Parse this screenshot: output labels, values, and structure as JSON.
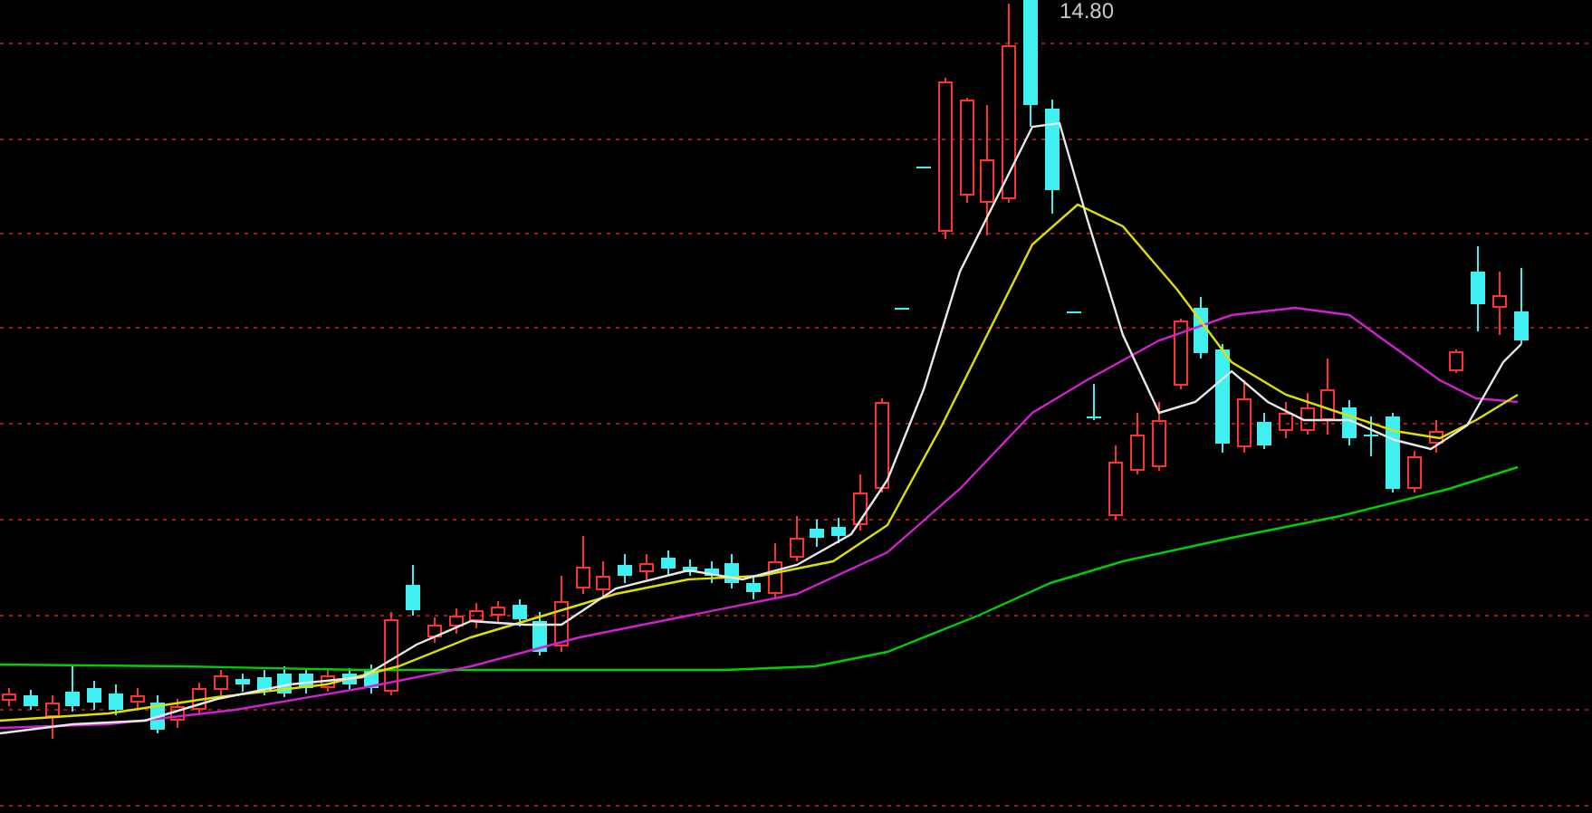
{
  "chart": {
    "price_label": "14.80"
  }
}
